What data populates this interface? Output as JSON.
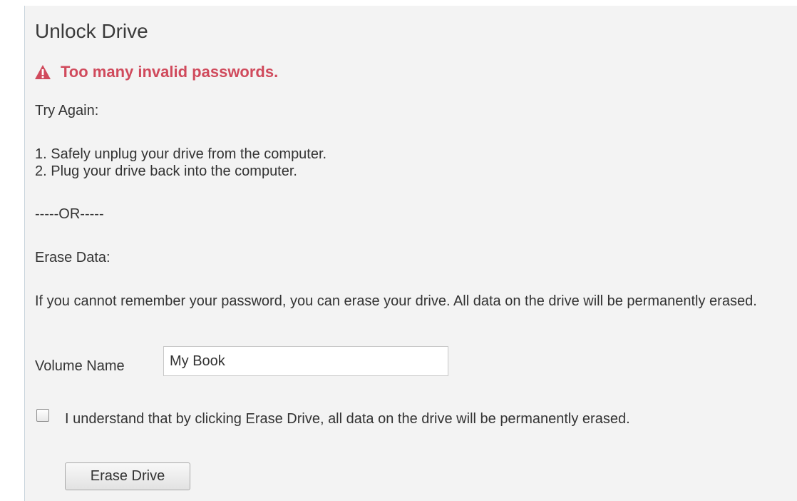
{
  "dialog": {
    "title": "Unlock Drive",
    "alert_icon": "warning-triangle-icon",
    "alert_color": "#d04a5c",
    "alert_message": "Too many invalid passwords.",
    "try_again_heading": "Try Again:",
    "steps": [
      "1. Safely unplug your drive from the computer.",
      "2. Plug your drive back into the computer."
    ],
    "separator": "-----OR-----",
    "erase_heading": "Erase Data:",
    "erase_description": "If you cannot remember your password, you can erase your drive. All data on the drive will be permanently erased.",
    "volume_label": "Volume Name",
    "volume_value": "My Book",
    "confirm_checked": false,
    "confirm_text": "I understand that by clicking Erase Drive, all data on the drive will be permanently erased.",
    "erase_button": "Erase Drive"
  }
}
